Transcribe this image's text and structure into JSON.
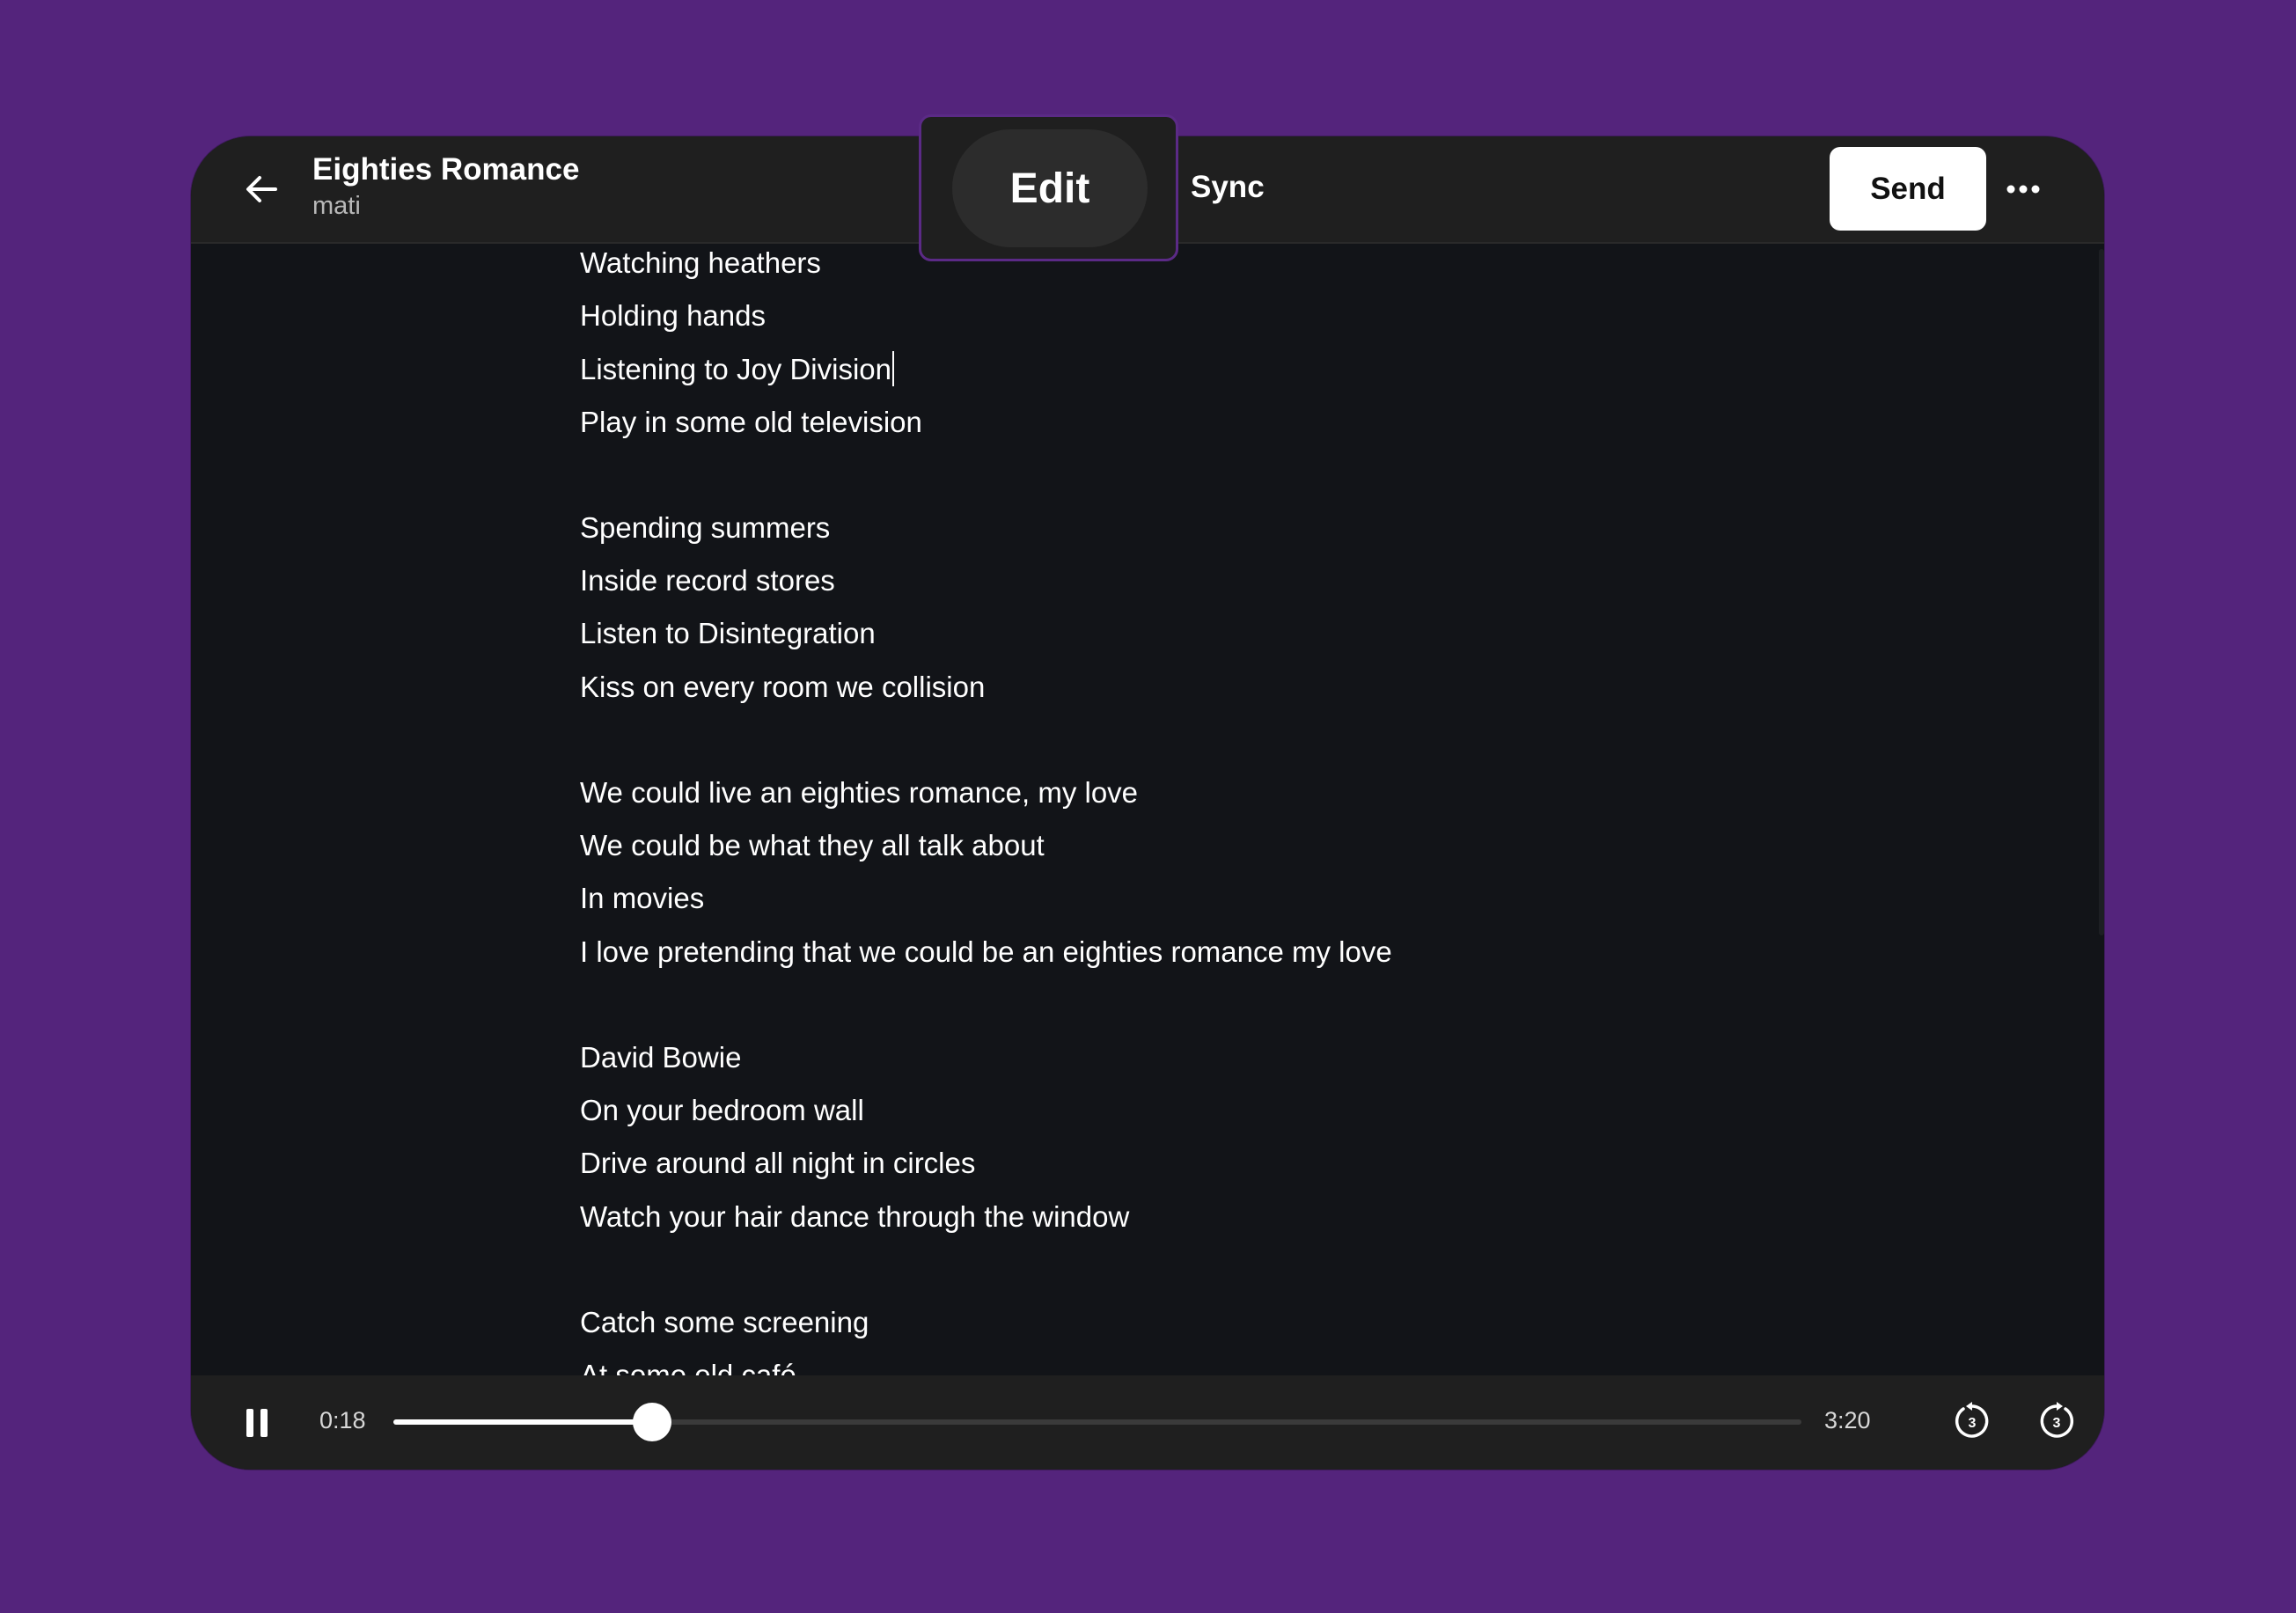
{
  "header": {
    "back_icon": "arrow-left-icon",
    "title": "Eighties Romance",
    "subtitle": "mati",
    "tabs": [
      {
        "label": "Edit",
        "active": true
      },
      {
        "label": "Sync",
        "active": false
      }
    ],
    "info_icon": "info-circle-icon",
    "review_icon": "document-check-icon",
    "send_label": "Send",
    "more_icon": "more-horizontal-icon"
  },
  "lyrics": {
    "caret_line_index": 2,
    "lines": [
      "Watching heathers",
      "Holding hands",
      "Listening to Joy Division",
      "Play in some old television",
      "",
      "Spending summers",
      "Inside record stores",
      "Listen to Disintegration",
      "Kiss on every room we collision",
      "",
      "We could live an eighties romance, my love",
      "We could be what they all talk about",
      "In movies",
      "I love pretending that we could be an eighties romance my love",
      "",
      "David Bowie",
      "On your bedroom wall",
      "Drive around all night in circles",
      "Watch your hair dance through the window",
      "",
      "Catch some screening",
      "At some old café"
    ]
  },
  "player": {
    "pause_icon": "pause-icon",
    "current_time": "0:18",
    "total_time": "3:20",
    "progress": 0.09,
    "rewind_icon": "rewind-3-seconds-icon",
    "rewind_label": "3",
    "forward_icon": "forward-3-seconds-icon",
    "forward_label": "3"
  },
  "colors": {
    "background": "#54247c",
    "window": "#121418",
    "header": "#1f1f1f",
    "popup_border": "#5b2a86",
    "text": "#ffffff"
  }
}
